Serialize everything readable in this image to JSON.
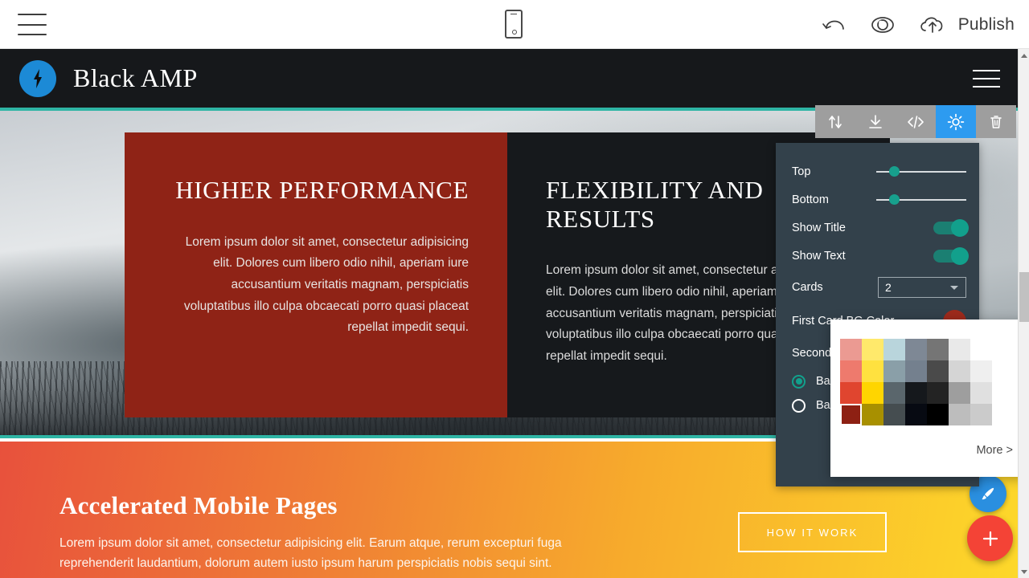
{
  "editor_bar": {
    "menu_icon": "hamburger-icon",
    "device_icon": "mobile-device-icon",
    "undo_icon": "undo-arrow-icon",
    "preview_icon": "eye-icon",
    "publish_icon": "cloud-upload-icon",
    "publish_label": "Publish"
  },
  "site_header": {
    "logo_icon": "lightning-bolt-icon",
    "brand": "Black AMP",
    "menu_icon": "hamburger-icon"
  },
  "hero": {
    "cards": [
      {
        "title": "HIGHER PERFORMANCE",
        "text": "Lorem ipsum dolor sit amet, consectetur adipisicing elit. Dolores cum libero odio nihil, aperiam iure accusantium veritatis magnam, perspiciatis voluptatibus illo culpa obcaecati porro quasi placeat repellat impedit sequi.",
        "bg_color": "#8f2316"
      },
      {
        "title": "FLEXIBILITY AND RESULTS",
        "text": "Lorem ipsum dolor sit amet, consectetur adipisicing elit. Dolores cum libero odio nihil, aperiam iure accusantium veritatis magnam, perspiciatis voluptatibus illo culpa obcaecati porro quasi placeat repellat impedit sequi.",
        "bg_color": "#16191c"
      }
    ],
    "accent_color": "#2fb5a5"
  },
  "promo": {
    "title": "Accelerated Mobile Pages",
    "text": "Lorem ipsum dolor sit amet, consectetur adipisicing elit. Earum atque, rerum excepturi fuga reprehenderit laudantium, dolorum autem iusto ipsum harum perspiciatis nobis sequi sint.",
    "button_label": "HOW IT WORK"
  },
  "block_toolbar": {
    "buttons": [
      {
        "name": "move-updown-icon",
        "active": false
      },
      {
        "name": "download-icon",
        "active": false
      },
      {
        "name": "code-icon",
        "active": false
      },
      {
        "name": "gear-icon",
        "active": true
      },
      {
        "name": "trash-icon",
        "active": false
      }
    ],
    "active_color": "#2d9bf0"
  },
  "settings_panel": {
    "rows": [
      {
        "label": "Top",
        "type": "slider",
        "value": 20
      },
      {
        "label": "Bottom",
        "type": "slider",
        "value": 20
      },
      {
        "label": "Show Title",
        "type": "toggle",
        "value": "on"
      },
      {
        "label": "Show Text",
        "type": "toggle",
        "value": "on"
      },
      {
        "label": "Cards",
        "type": "select",
        "value": "2"
      },
      {
        "label": "First Card BG Color",
        "type": "color",
        "value": "#9e2a1c"
      },
      {
        "label": "Second",
        "type": "label"
      }
    ],
    "radios": [
      {
        "label": "Back",
        "selected": true
      },
      {
        "label": "Back",
        "selected": false
      }
    ],
    "accent_color": "#12a08c"
  },
  "palette": {
    "more_label": "More >",
    "selected_index": 21,
    "swatches": [
      "#eb9a92",
      "#ffe96b",
      "#b9d5dc",
      "#7e8895",
      "#757575",
      "#e9e9e9",
      "#ffffff",
      "#ee7a6d",
      "#ffe13f",
      "#8a9fa8",
      "#74808e",
      "#4a4a4a",
      "#d5d5d5",
      "#efefef",
      "#e0452f",
      "#ffd500",
      "#5a666c",
      "#15181c",
      "#232323",
      "#9e9e9e",
      "#e0e0e0",
      "#8d2013",
      "#a89000",
      "#454d50",
      "#070a12",
      "#000000",
      "#bdbdbd",
      "#cbcbcb"
    ]
  },
  "fabs": {
    "brush_icon": "brush-icon",
    "brush_color": "#2a8fe0",
    "add_icon": "plus-icon",
    "add_color": "#f44336"
  },
  "scrollbar": {
    "up_icon": "scroll-up-arrow-icon",
    "down_icon": "scroll-down-arrow-icon"
  }
}
